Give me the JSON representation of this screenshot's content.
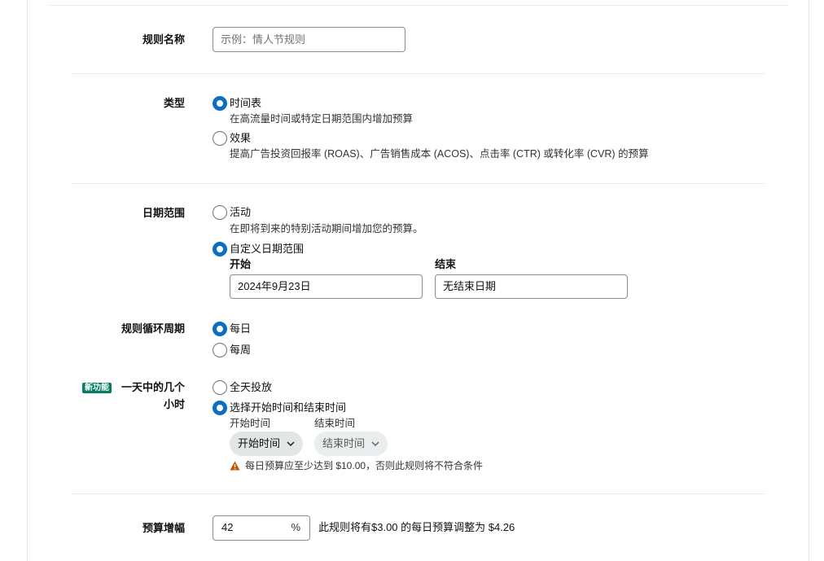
{
  "rule_name": {
    "label": "规则名称",
    "placeholder": "示例：情人节规则"
  },
  "type": {
    "label": "类型",
    "options": [
      {
        "label": "时间表",
        "desc": "在高流量时间或特定日期范围内增加预算",
        "selected": true
      },
      {
        "label": "效果",
        "desc": "提高广告投资回报率 (ROAS)、广告销售成本 (ACOS)、点击率 (CTR) 或转化率 (CVR) 的预算",
        "selected": false
      }
    ]
  },
  "date_range": {
    "label": "日期范围",
    "options": [
      {
        "label": "活动",
        "desc": "在即将到来的特别活动期间增加您的预算。",
        "selected": false
      },
      {
        "label": "自定义日期范围",
        "selected": true
      }
    ],
    "start_label": "开始",
    "start_value": "2024年9月23日",
    "end_label": "结束",
    "end_value": "无结束日期"
  },
  "recurrence": {
    "label": "规则循环周期",
    "options": [
      {
        "label": "每日",
        "selected": true
      },
      {
        "label": "每周",
        "selected": false
      }
    ]
  },
  "hours": {
    "badge": "新功能",
    "label_line1": "一天中的几个",
    "label_line2": "小时",
    "options": [
      {
        "label": "全天投放",
        "selected": false
      },
      {
        "label": "选择开始时间和结束时间",
        "selected": true
      }
    ],
    "start_label": "开始时间",
    "start_button": "开始时间",
    "end_label": "结束时间",
    "end_button": "结束时间",
    "warning": "每日预算应至少达到 $10.00，否则此规则将不符合条件"
  },
  "budget_increase": {
    "label": "预算增幅",
    "value": "42",
    "unit": "%",
    "note": "此规则将有$3.00 的每日预算调整为 $4.26"
  },
  "colors": {
    "accent": "#0a6fc2",
    "badge": "#067d62",
    "warning": "#c45500"
  }
}
